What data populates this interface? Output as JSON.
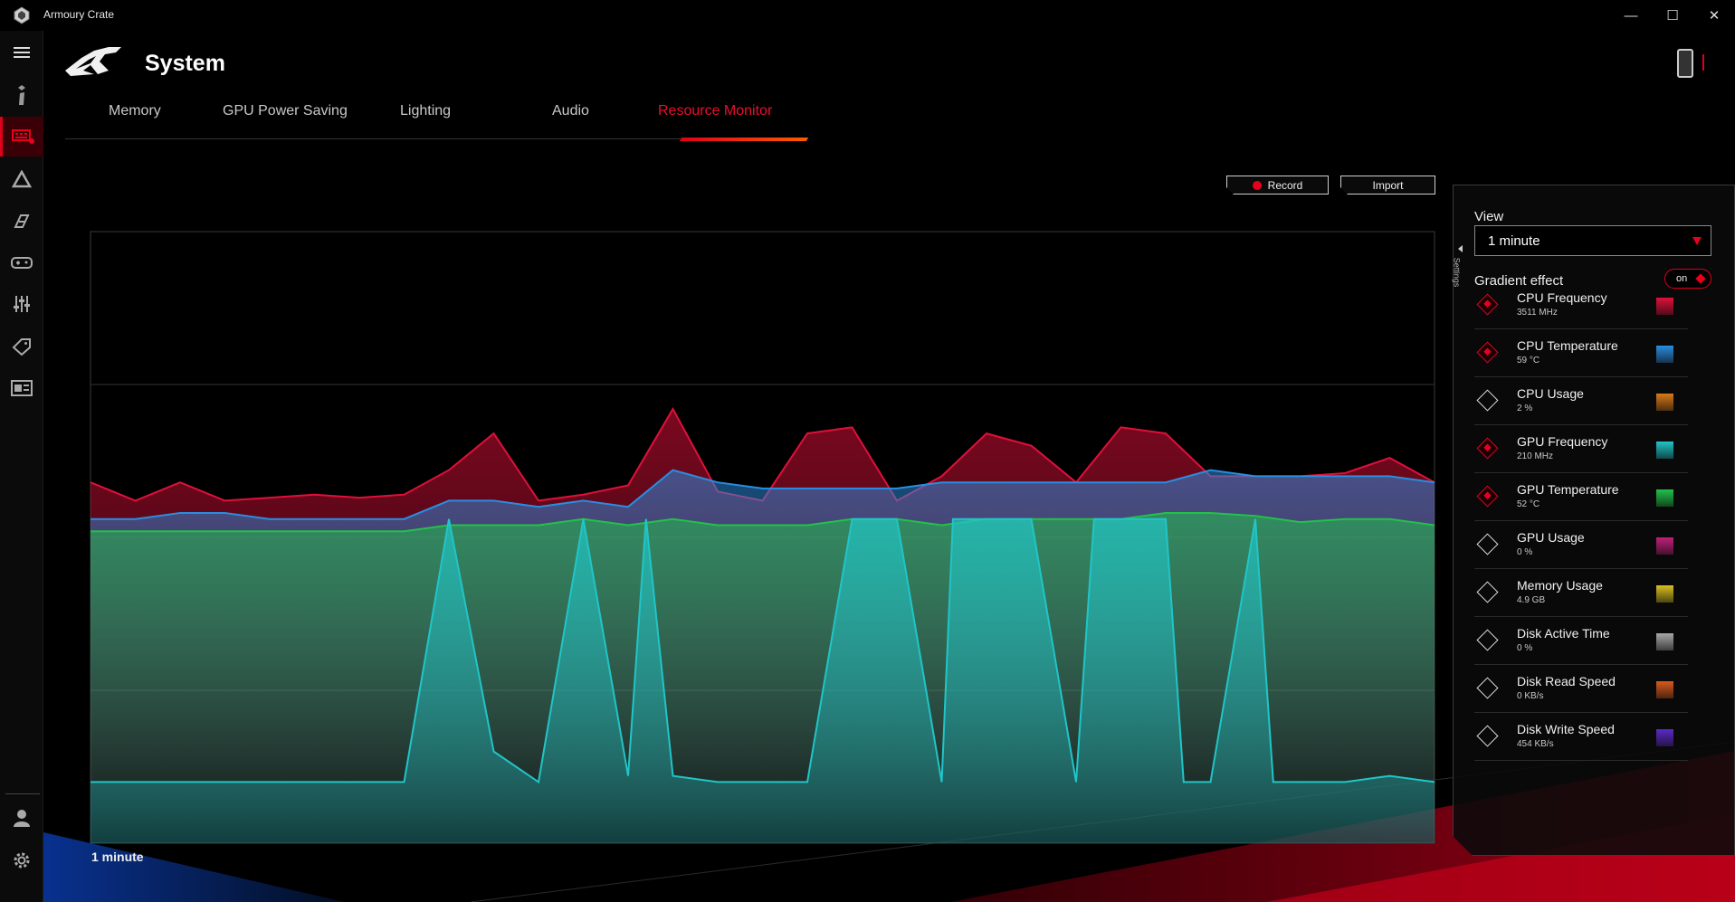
{
  "window": {
    "title": "Armoury Crate",
    "minimize_glyph": "—",
    "maximize_glyph": "☐",
    "close_glyph": "✕"
  },
  "sidebar": {
    "items": [
      {
        "icon": "menu-icon"
      },
      {
        "icon": "info-icon"
      },
      {
        "icon": "device-icon",
        "active": true
      },
      {
        "icon": "aura-sync-icon"
      },
      {
        "icon": "game-visual-icon"
      },
      {
        "icon": "gamepad-icon"
      },
      {
        "icon": "sliders-icon"
      },
      {
        "icon": "tag-icon"
      },
      {
        "icon": "featured-icon"
      },
      {
        "icon": "user-icon"
      },
      {
        "icon": "gear-icon"
      }
    ]
  },
  "header": {
    "title": "System",
    "tabs": [
      {
        "label": "Memory"
      },
      {
        "label": "GPU Power Saving"
      },
      {
        "label": "Lighting"
      },
      {
        "label": "Audio"
      },
      {
        "label": "Resource Monitor",
        "active": true
      }
    ]
  },
  "actions": {
    "record_label": "Record",
    "import_label": "Import"
  },
  "chart_footer": "1 minute",
  "settings": {
    "tab_label": "Settings",
    "view_label": "View",
    "view_value": "1  minute",
    "gradient_label": "Gradient effect",
    "gradient_state": "on",
    "metrics": [
      {
        "name": "CPU Frequency",
        "value": "3511 MHz",
        "checked": true,
        "color": "#e0103a"
      },
      {
        "name": "CPU Temperature",
        "value": "59 °C",
        "checked": true,
        "color": "#2a8de0"
      },
      {
        "name": "CPU Usage",
        "value": "2 %",
        "checked": false,
        "color": "#d77a1a"
      },
      {
        "name": "GPU Frequency",
        "value": "210 MHz",
        "checked": true,
        "color": "#20c5c8"
      },
      {
        "name": "GPU Temperature",
        "value": "52 °C",
        "checked": true,
        "color": "#22c24a"
      },
      {
        "name": "GPU Usage",
        "value": "0 %",
        "checked": false,
        "color": "#c0207a"
      },
      {
        "name": "Memory Usage",
        "value": "4.9 GB",
        "checked": false,
        "color": "#d8c020"
      },
      {
        "name": "Disk Active Time",
        "value": "0 %",
        "checked": false,
        "color": "#a8a8a8"
      },
      {
        "name": "Disk Read Speed",
        "value": "0 KB/s",
        "checked": false,
        "color": "#d85a1e"
      },
      {
        "name": "Disk Write Speed",
        "value": "454 KB/s",
        "checked": false,
        "color": "#5b2ac8"
      }
    ]
  },
  "chart_data": {
    "type": "area",
    "xlim": [
      0,
      60
    ],
    "ylim": [
      0,
      100
    ],
    "grid": true,
    "series": [
      {
        "name": "CPU Frequency",
        "color": "#e0103a",
        "x": [
          0,
          2,
          4,
          6,
          8,
          10,
          12,
          14,
          16,
          18,
          20,
          22,
          24,
          26,
          28,
          30,
          32,
          34,
          36,
          38,
          40,
          42,
          44,
          46,
          48,
          50,
          52,
          54,
          56,
          58,
          60
        ],
        "y": [
          59,
          56,
          59,
          56,
          56.5,
          57,
          56.5,
          57,
          61,
          67,
          56,
          57,
          58.5,
          71,
          57.5,
          56,
          67,
          68,
          56,
          60,
          67,
          65,
          59,
          68,
          67,
          60,
          60,
          60,
          60.5,
          63,
          59
        ]
      },
      {
        "name": "CPU Temperature",
        "color": "#2a8de0",
        "x": [
          0,
          2,
          4,
          6,
          8,
          10,
          12,
          14,
          16,
          18,
          20,
          22,
          24,
          26,
          28,
          30,
          32,
          34,
          36,
          38,
          40,
          42,
          44,
          46,
          48,
          50,
          52,
          54,
          56,
          58,
          60
        ],
        "y": [
          53,
          53,
          54,
          54,
          53,
          53,
          53,
          53,
          56,
          56,
          55,
          56,
          55,
          61,
          59,
          58,
          58,
          58,
          58,
          59,
          59,
          59,
          59,
          59,
          59,
          61,
          60,
          60,
          60,
          60,
          59
        ]
      },
      {
        "name": "GPU Temperature",
        "color": "#22c24a",
        "x": [
          0,
          2,
          4,
          6,
          8,
          10,
          12,
          14,
          16,
          18,
          20,
          22,
          24,
          26,
          28,
          30,
          32,
          34,
          36,
          38,
          40,
          42,
          44,
          46,
          48,
          50,
          52,
          54,
          56,
          58,
          60
        ],
        "y": [
          51,
          51,
          51,
          51,
          51,
          51,
          51,
          51,
          52,
          52,
          52,
          53,
          52,
          53,
          52,
          52,
          52,
          53,
          53,
          52,
          53,
          53,
          53,
          53,
          54,
          54,
          53.5,
          52.5,
          53,
          53,
          52
        ]
      },
      {
        "name": "GPU Frequency",
        "color": "#20c5c8",
        "x": [
          0,
          14,
          16,
          18,
          20,
          22,
          24,
          24.8,
          26,
          28,
          30,
          32,
          34,
          36,
          38,
          38.5,
          40,
          42,
          44,
          44.8,
          46,
          48,
          48.8,
          50,
          52,
          52.8,
          54,
          56,
          58,
          60
        ],
        "y": [
          10,
          10,
          53,
          15,
          10,
          53,
          11,
          53,
          11,
          10,
          10,
          10,
          53,
          53,
          10,
          53,
          53,
          53,
          10,
          53,
          53,
          53,
          10,
          10,
          53,
          10,
          10,
          10,
          11,
          10
        ]
      }
    ]
  }
}
